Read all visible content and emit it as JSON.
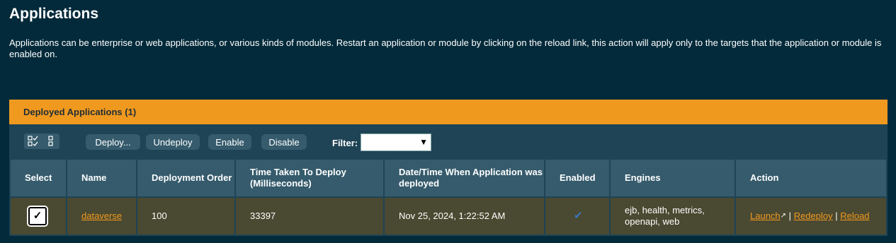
{
  "page": {
    "title": "Applications",
    "description": "Applications can be enterprise or web applications, or various kinds of modules. Restart an application or module by clicking on the reload link, this action will apply only to the targets that the application or module is enabled on."
  },
  "panel": {
    "header": "Deployed Applications (1)"
  },
  "toolbar": {
    "select_all_icon": "select-all-icon",
    "deselect_all_icon": "deselect-all-icon",
    "deploy_label": "Deploy...",
    "undeploy_label": "Undeploy",
    "enable_label": "Enable",
    "disable_label": "Disable",
    "filter_label": "Filter:",
    "filter_value": ""
  },
  "table": {
    "columns": [
      "Select",
      "Name",
      "Deployment Order",
      "Time Taken To Deploy (Milliseconds)",
      "Date/Time When Application was deployed",
      "Enabled",
      "Engines",
      "Action"
    ],
    "rows": [
      {
        "selected": true,
        "name": "dataverse",
        "deployment_order": "100",
        "time_taken": "33397",
        "deployed_at": "Nov 25, 2024, 1:22:52 AM",
        "enabled": true,
        "engines": "ejb, health, metrics, openapi, web",
        "actions": {
          "launch": "Launch",
          "redeploy": "Redeploy",
          "reload": "Reload",
          "separator": "|"
        }
      }
    ]
  },
  "colors": {
    "background": "#032a3a",
    "accent": "#f0991f",
    "row_bg": "#4a4931",
    "header_bg": "#355b6c"
  }
}
